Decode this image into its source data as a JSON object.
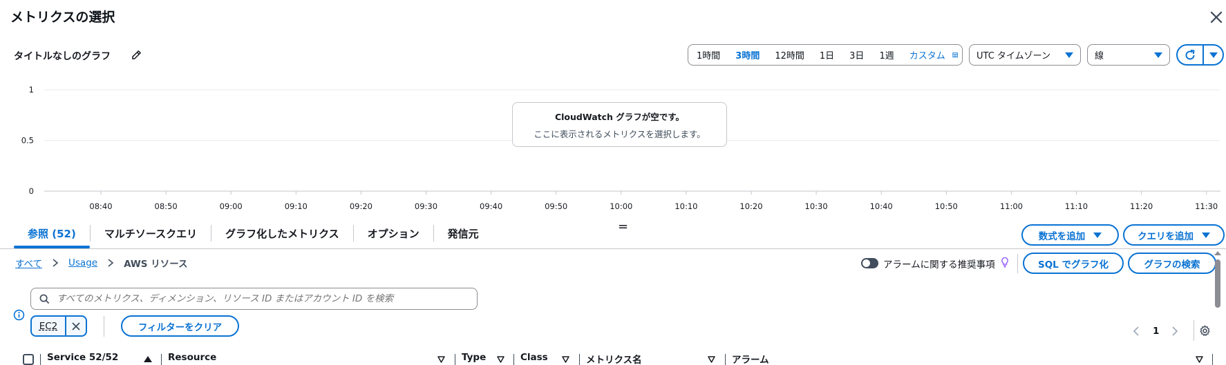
{
  "header": {
    "title": "メトリクスの選択",
    "graph_title": "タイトルなしのグラフ"
  },
  "time_range": {
    "options": [
      "1時間",
      "3時間",
      "12時間",
      "1日",
      "3日",
      "1週"
    ],
    "active": "3時間",
    "custom_label": "カスタム"
  },
  "timezone": {
    "value": "UTC タイムゾーン"
  },
  "graph_type": {
    "value": "線"
  },
  "colors": {
    "accent": "#0972d3",
    "text": "#16191f",
    "border": "#8c8c94",
    "grid": "#e9ebed"
  },
  "chart_data": {
    "type": "line",
    "y_ticks": [
      "1",
      "0.5",
      "0"
    ],
    "x_ticks": [
      "08:40",
      "08:50",
      "09:00",
      "09:10",
      "09:20",
      "09:30",
      "09:40",
      "09:50",
      "10:00",
      "10:10",
      "10:20",
      "10:30",
      "10:40",
      "10:50",
      "11:00",
      "11:10",
      "11:20",
      "11:30"
    ],
    "ylim": [
      0,
      1
    ],
    "series": [],
    "empty_title": "CloudWatch グラフが空です。",
    "empty_subtitle": "ここに表示されるメトリクスを選択します。"
  },
  "tabs": [
    {
      "label": "参照 (52)",
      "active": true
    },
    {
      "label": "マルチソースクエリ",
      "active": false
    },
    {
      "label": "グラフ化したメトリクス",
      "active": false
    },
    {
      "label": "オプション",
      "active": false
    },
    {
      "label": "発信元",
      "active": false
    }
  ],
  "actions": {
    "add_formula": "数式を追加",
    "add_query": "クエリを追加",
    "sql_graph": "SQL でグラフ化",
    "search_graph": "グラフの検索",
    "clear_filters": "フィルターをクリア"
  },
  "breadcrumb": {
    "all": "すべて",
    "usage": "Usage",
    "current": "AWS リソース"
  },
  "alarm_toggle": {
    "label": "アラームに関する推奨事項",
    "enabled": false
  },
  "search": {
    "placeholder": "すべてのメトリクス、ディメンション、リソース ID またはアカウント ID を検索"
  },
  "filter_token": {
    "label": "EC2"
  },
  "pagination": {
    "current_page": "1"
  },
  "table": {
    "columns": {
      "service": "Service 52/52",
      "resource": "Resource",
      "type": "Type",
      "class": "Class",
      "metric_name": "メトリクス名",
      "alarm": "アラーム"
    }
  },
  "icons": {
    "close": "close-icon",
    "edit": "pencil-icon",
    "calendar": "calendar-icon",
    "refresh": "refresh-icon",
    "search": "search-icon",
    "info": "info-icon",
    "settings": "gear-icon",
    "bulb": "lightbulb-icon"
  }
}
